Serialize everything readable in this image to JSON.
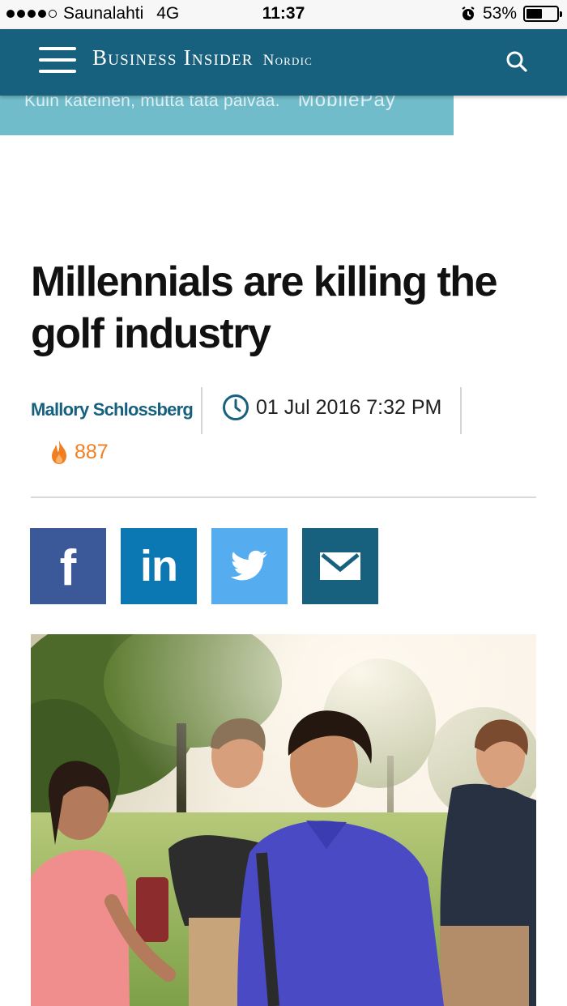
{
  "status_bar": {
    "carrier": "Saunalahti",
    "network": "4G",
    "time": "11:37",
    "battery": "53%",
    "battery_level": 0.53,
    "signal_dots_filled": 4,
    "signal_dots_total": 5
  },
  "header": {
    "brand": "Business Insider",
    "edition": "Nordic",
    "background_color": "#17617f"
  },
  "ad_banner": {
    "text": "Kuin käteinen, mutta tätä päivää.",
    "brand": "MobilePay"
  },
  "article": {
    "headline": "Millennials are killing the golf industry",
    "author": "Mallory Schlossberg",
    "date": "01 Jul 2016 7:32 PM",
    "views": "887"
  },
  "share_buttons": [
    {
      "network": "facebook",
      "icon": "facebook-icon",
      "color": "#3b5998"
    },
    {
      "network": "linkedin",
      "icon": "linkedin-icon",
      "color": "#0b78b3"
    },
    {
      "network": "twitter",
      "icon": "twitter-icon",
      "color": "#55acee"
    },
    {
      "network": "email",
      "icon": "mail-icon",
      "color": "#17617f"
    }
  ],
  "hero_image": {
    "subject": "four young golfers walking on a sunny golf course"
  }
}
